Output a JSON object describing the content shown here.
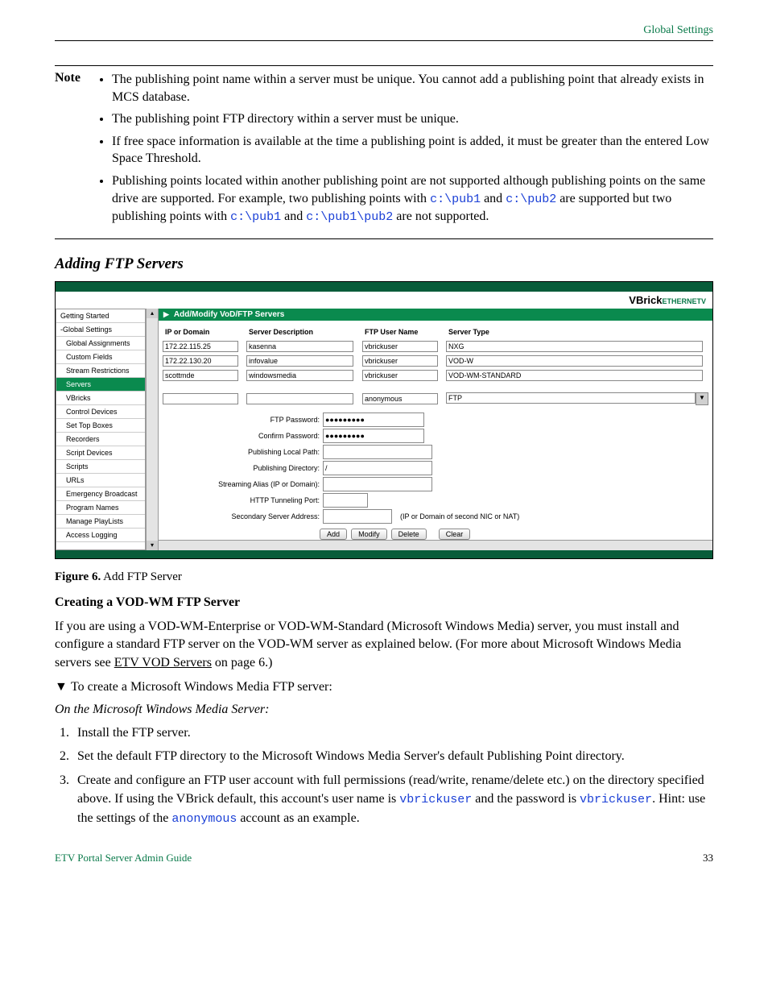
{
  "header": "Global Settings",
  "note": {
    "label": "Note",
    "items": [
      {
        "text": "The publishing point name within a server must be unique. You cannot add a publishing point that already exists in MCS database."
      },
      {
        "text": "The publishing point FTP directory within a server must be unique."
      },
      {
        "text": "If free space information is available at the time a publishing point is added, it must be greater than the entered Low Space Threshold."
      }
    ],
    "item4": {
      "a": "Publishing points located within another publishing point are not supported although publishing points on the same drive are supported. For example, two publishing points with ",
      "c1": "c:\\pub1",
      "b": " and ",
      "c2": "c:\\pub2",
      "c": " are supported but two publishing points with ",
      "c3": "c:\\pub1",
      "d": " and ",
      "c4": "c:\\pub1\\pub2",
      "e": " are not supported."
    }
  },
  "h3": "Adding FTP Servers",
  "app": {
    "logo": {
      "a": "VBrick",
      "b": "ETHERNETV"
    },
    "crumb": "Add/Modify VoD/FTP Servers",
    "sidebar": [
      {
        "t": "Getting Started",
        "sub": false,
        "a": false
      },
      {
        "t": "-Global Settings",
        "sub": false,
        "a": false
      },
      {
        "t": "Global Assignments",
        "sub": true,
        "a": false
      },
      {
        "t": "Custom Fields",
        "sub": true,
        "a": false
      },
      {
        "t": "Stream Restrictions",
        "sub": true,
        "a": false
      },
      {
        "t": "Servers",
        "sub": true,
        "a": true
      },
      {
        "t": "VBricks",
        "sub": true,
        "a": false
      },
      {
        "t": "Control Devices",
        "sub": true,
        "a": false
      },
      {
        "t": "Set Top Boxes",
        "sub": true,
        "a": false
      },
      {
        "t": "Recorders",
        "sub": true,
        "a": false
      },
      {
        "t": "Script Devices",
        "sub": true,
        "a": false
      },
      {
        "t": "Scripts",
        "sub": true,
        "a": false
      },
      {
        "t": "URLs",
        "sub": true,
        "a": false
      },
      {
        "t": "Emergency Broadcast",
        "sub": true,
        "a": false
      },
      {
        "t": "Program Names",
        "sub": true,
        "a": false
      },
      {
        "t": "Manage PlayLists",
        "sub": true,
        "a": false
      },
      {
        "t": "Access Logging",
        "sub": true,
        "a": false
      }
    ],
    "thead": {
      "ip": "IP or Domain",
      "desc": "Server Description",
      "user": "FTP User Name",
      "type": "Server Type"
    },
    "rows": [
      {
        "ip": "172.22.115.25",
        "desc": "kasenna",
        "user": "vbrickuser",
        "type": "NXG"
      },
      {
        "ip": "172.22.130.20",
        "desc": "infovalue",
        "user": "vbrickuser",
        "type": "VOD-W"
      },
      {
        "ip": "scottmde",
        "desc": "windowsmedia",
        "user": "vbrickuser",
        "type": "VOD-WM-STANDARD"
      }
    ],
    "blank": {
      "ip": "",
      "desc": "",
      "user": "anonymous",
      "type": "FTP"
    },
    "fields": {
      "pass": "FTP Password:",
      "passv": "●●●●●●●●●",
      "cpass": "Confirm Password:",
      "cpassv": "●●●●●●●●●",
      "plp": "Publishing Local Path:",
      "plpv": "",
      "pd": "Publishing Directory:",
      "pdv": "/",
      "alias": "Streaming Alias (IP or Domain):",
      "tun": "HTTP Tunneling Port:",
      "sec": "Secondary Server Address:",
      "secnote": "(IP or Domain of second NIC or NAT)"
    },
    "buttons": {
      "add": "Add",
      "mod": "Modify",
      "del": "Delete",
      "clr": "Clear"
    }
  },
  "fig": {
    "b": "Figure 6.",
    "t": "  Add FTP Server"
  },
  "h4": "Creating a VOD-WM FTP Server",
  "p1": {
    "a": "If you are using a VOD-WM-Enterprise or VOD-WM-Standard (Microsoft Windows Media) server, you must install and configure a standard FTP server on the VOD-WM server as explained below. (For more about Microsoft Windows Media servers see ",
    "link": "ETV VOD Servers",
    "b": " on page 6.)"
  },
  "proc": "To create a Microsoft Windows Media FTP server:",
  "ital": "On the Microsoft Windows Media Server:",
  "steps": {
    "s1": "Install the FTP server.",
    "s2": "Set the default FTP directory to the Microsoft Windows Media Server's default Publishing Point directory.",
    "s3": {
      "a": "Create and configure an FTP user account with full permissions (read/write, rename/delete etc.) on the directory specified above. If using the VBrick default, this account's user name is ",
      "m1": "vbrickuser",
      "b": " and the password is ",
      "m2": "vbrickuser",
      "c": ". Hint: use the settings of the ",
      "m3": "anonymous",
      "d": " account as an example."
    }
  },
  "footer": {
    "l": "ETV Portal Server Admin Guide",
    "r": "33"
  }
}
